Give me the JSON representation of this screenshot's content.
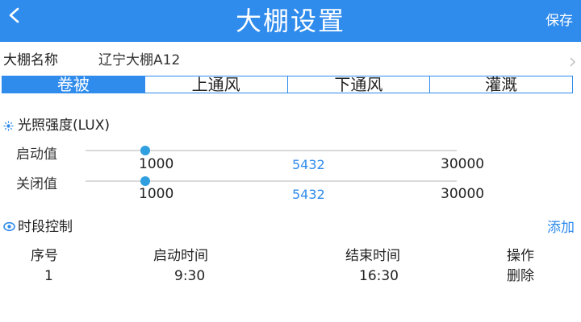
{
  "header": {
    "title": "大棚设置",
    "save_label": "保存",
    "back_icon": "back-arrow-icon"
  },
  "greenhouse": {
    "name_label": "大棚名称",
    "name_value": "辽宁大棚A12"
  },
  "tabs": [
    {
      "label": "卷被",
      "active": true
    },
    {
      "label": "上通风",
      "active": false
    },
    {
      "label": "下通风",
      "active": false
    },
    {
      "label": "灌溉",
      "active": false
    }
  ],
  "light": {
    "title": "光照强度(LUX)",
    "icon": "sun-icon",
    "min": 1000,
    "max": 30000,
    "min_label": "1000",
    "max_label": "30000",
    "start": {
      "label": "启动值",
      "value": 1000,
      "current_label": "5432"
    },
    "stop": {
      "label": "关闭值",
      "value": 1000,
      "current_label": "5432"
    }
  },
  "schedule": {
    "title": "时段控制",
    "icon": "eye-icon",
    "add_label": "添加",
    "columns": [
      "序号",
      "启动时间",
      "结束时间",
      "操作"
    ],
    "rows": [
      {
        "index": "1",
        "start": "9:30",
        "end": "16:30",
        "action": "删除"
      }
    ]
  },
  "colors": {
    "accent": "#2f8bec",
    "knob": "#2f9fe0",
    "track": "#d9d9d9"
  }
}
